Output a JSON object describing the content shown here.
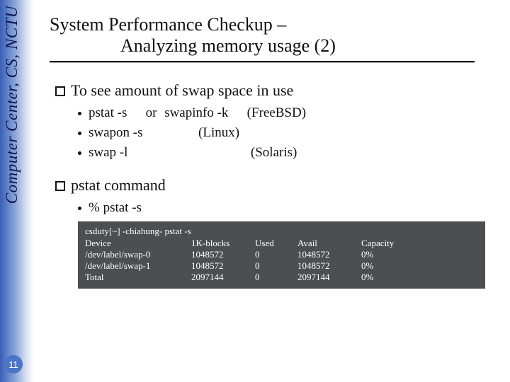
{
  "sidebar": {
    "org_label": "Computer Center, CS, NCTU",
    "page_number": "11"
  },
  "title": {
    "line1": "System Performance Checkup –",
    "line2": "Analyzing memory usage (2)"
  },
  "section_swap": {
    "heading": "To see amount of swap space in use",
    "items": [
      {
        "cmd1": "pstat -s",
        "or": "or",
        "cmd2": "swapinfo -k",
        "os": "(FreeBSD)"
      },
      {
        "cmd1": "swapon -s",
        "os": "(Linux)"
      },
      {
        "cmd1": "swap -l",
        "os": "(Solaris)"
      }
    ]
  },
  "section_pstat": {
    "heading": "pstat command",
    "sub": "% pstat -s"
  },
  "terminal": {
    "prompt": "csduty[~] -chiahung- pstat -s",
    "headers": {
      "device": "Device",
      "blocks": "1K-blocks",
      "used": "Used",
      "avail": "Avail",
      "capacity": "Capacity"
    },
    "rows": [
      {
        "device": "/dev/label/swap-0",
        "blocks": "1048572",
        "used": "0",
        "avail": "1048572",
        "capacity": "0%"
      },
      {
        "device": "/dev/label/swap-1",
        "blocks": "1048572",
        "used": "0",
        "avail": "1048572",
        "capacity": "0%"
      },
      {
        "device": "Total",
        "blocks": "2097144",
        "used": "0",
        "avail": "2097144",
        "capacity": "0%"
      }
    ]
  }
}
